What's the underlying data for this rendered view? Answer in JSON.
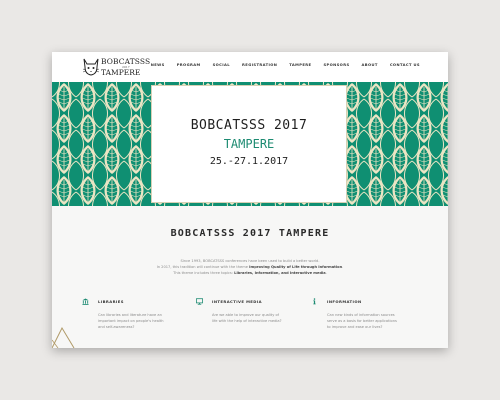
{
  "brand": {
    "line1": "BOBCATSSS",
    "line2": "2017",
    "line3": "TAMPERE"
  },
  "nav": [
    "NEWS",
    "PROGRAM",
    "SOCIAL",
    "REGISTRATION",
    "TAMPERE",
    "SPONSORS",
    "ABOUT",
    "CONTACT US"
  ],
  "hero": {
    "title": "BOBCATSSS 2017",
    "subtitle": "TAMPERE",
    "dates": "25.-27.1.2017"
  },
  "main": {
    "title": "BOBCATSSS 2017 TAMPERE",
    "intro_line1": "Since 1993, BOBCATSSS conferences have been used to build a better world.",
    "intro_line2_pre": "In 2017, this tradition will continue with the theme ",
    "intro_line2_bold": "Improving Quality of Life through Information",
    "intro_line2_post": ".",
    "intro_line3_pre": "This theme includes three topics: ",
    "intro_line3_bold": "Libraries, Information, and Interactive media",
    "intro_line3_post": "."
  },
  "topics": [
    {
      "title": "LIBRARIES",
      "icon": "library-icon",
      "text": "Can libraries and literature have an important impact on people's health and self-awareness?"
    },
    {
      "title": "INTERACTIVE MEDIA",
      "icon": "monitor-icon",
      "text": "Are we able to improve our quality of life with the help of interactive media?"
    },
    {
      "title": "INFORMATION",
      "icon": "info-icon",
      "text": "Can new kinds of information sources serve as a basis for better applications to improve and ease our lives?"
    }
  ],
  "colors": {
    "accent": "#1d8b72",
    "pattern_green": "#0f8f72",
    "pattern_cream": "#ece5c4",
    "gold": "#b09a68"
  }
}
